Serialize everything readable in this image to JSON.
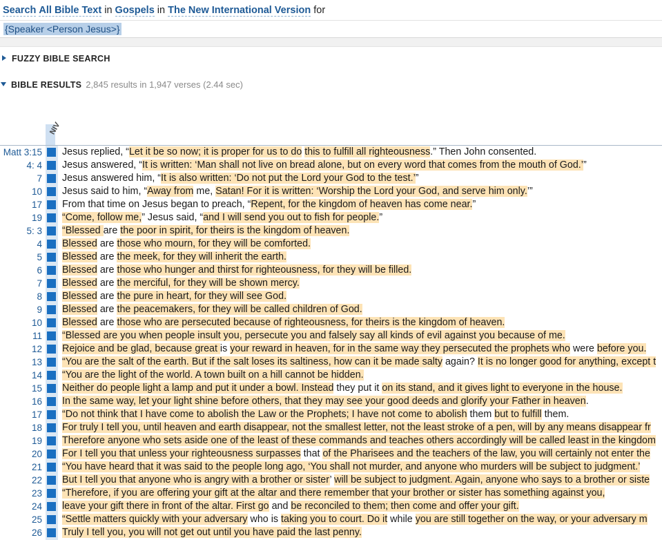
{
  "search": {
    "prefix": "Search",
    "scope": "All Bible Text",
    "in1": "in",
    "range": "Gospels",
    "in2": "in",
    "version": "The New International Version",
    "for": "for",
    "query": "{Speaker <Person Jesus>}"
  },
  "sections": {
    "fuzzy": "FUZZY BIBLE SEARCH",
    "results": "BIBLE RESULTS",
    "results_count": "2,845 results in 1,947 verses (2.44 sec)"
  },
  "version_column": "NIV",
  "colors": {
    "accent": "#1e5a96",
    "highlight": "#fde3b6",
    "marker": "#1a6fc1"
  },
  "results": [
    {
      "ref": "Matt 3:15",
      "segs": [
        [
          "Jesus replied, “",
          0
        ],
        [
          "Let it be so now; it is proper for us to do",
          1
        ],
        [
          " ",
          0
        ],
        [
          "this to fulfill all righteousness",
          1
        ],
        [
          ".” Then John consented.",
          0
        ]
      ]
    },
    {
      "ref": "4:  4",
      "segs": [
        [
          "Jesus answered, “",
          0
        ],
        [
          "It is written: ‘Man shall not live on bread alone, but on every word that comes from the mouth of God.’",
          1
        ],
        [
          "”",
          0
        ]
      ]
    },
    {
      "ref": "7",
      "segs": [
        [
          "Jesus answered him, “",
          0
        ],
        [
          "It is also written: ‘Do not put the Lord your God to the test.’",
          1
        ],
        [
          "”",
          0
        ]
      ]
    },
    {
      "ref": "10",
      "segs": [
        [
          "Jesus said to him, “",
          0
        ],
        [
          "Away from",
          1
        ],
        [
          " me, ",
          0
        ],
        [
          "Satan! For it is written: ‘Worship the Lord your God, and serve him only.",
          1
        ],
        [
          "’”",
          0
        ]
      ]
    },
    {
      "ref": "17",
      "segs": [
        [
          "From that time on Jesus began to preach, “",
          0
        ],
        [
          "Repent, for the kingdom of heaven has come near.",
          1
        ],
        [
          "”",
          0
        ]
      ]
    },
    {
      "ref": "19",
      "segs": [
        [
          "“Come, follow me,",
          1
        ],
        [
          "” Jesus said, “",
          0
        ],
        [
          "and I will send you out to fish for people.",
          1
        ],
        [
          "”",
          0
        ]
      ]
    },
    {
      "ref": "5:  3",
      "segs": [
        [
          "“Blessed ",
          1
        ],
        [
          "are ",
          0
        ],
        [
          "the poor in spirit, for theirs is the kingdom of heaven.",
          1
        ]
      ]
    },
    {
      "ref": "4",
      "segs": [
        [
          "Blessed",
          1
        ],
        [
          " are ",
          0
        ],
        [
          "those who mourn, for they will be comforted.",
          1
        ]
      ]
    },
    {
      "ref": "5",
      "segs": [
        [
          "Blessed",
          1
        ],
        [
          " are ",
          0
        ],
        [
          "the meek, for they will inherit the earth.",
          1
        ]
      ]
    },
    {
      "ref": "6",
      "segs": [
        [
          "Blessed",
          1
        ],
        [
          " are ",
          0
        ],
        [
          "those who hunger and thirst for righteousness, for they will be filled.",
          1
        ]
      ]
    },
    {
      "ref": "7",
      "segs": [
        [
          "Blessed",
          1
        ],
        [
          " are ",
          0
        ],
        [
          "the merciful, for they will be shown mercy.",
          1
        ]
      ]
    },
    {
      "ref": "8",
      "segs": [
        [
          "Blessed",
          1
        ],
        [
          " are ",
          0
        ],
        [
          "the pure in heart, for they will see God.",
          1
        ]
      ]
    },
    {
      "ref": "9",
      "segs": [
        [
          "Blessed",
          1
        ],
        [
          " are ",
          0
        ],
        [
          "the peacemakers, for they will be called children of God.",
          1
        ]
      ]
    },
    {
      "ref": "10",
      "segs": [
        [
          "Blessed",
          1
        ],
        [
          " are ",
          0
        ],
        [
          "those who are persecuted because of righteousness, for theirs is the kingdom of heaven.",
          1
        ]
      ]
    },
    {
      "ref": "11",
      "segs": [
        [
          "“Blessed are you when people insult you, persecute you and falsely say all kinds of evil against you because of me.",
          1
        ]
      ]
    },
    {
      "ref": "12",
      "segs": [
        [
          "Rejoice and be glad, because great ",
          1
        ],
        [
          "is ",
          0
        ],
        [
          "your reward in heaven, for in the same way they persecuted the prophets who",
          1
        ],
        [
          " were ",
          0
        ],
        [
          "before you.",
          1
        ]
      ]
    },
    {
      "ref": "13",
      "segs": [
        [
          "“You are the salt of the earth. But if the salt loses its saltiness, how can it be made salty",
          1
        ],
        [
          " again? ",
          0
        ],
        [
          "It is no longer good for anything, except t",
          1
        ]
      ]
    },
    {
      "ref": "14",
      "segs": [
        [
          "“You are the light of the world. A town built on a hill cannot be hidden.",
          1
        ]
      ]
    },
    {
      "ref": "15",
      "segs": [
        [
          "Neither do people light a lamp and put it under a bowl. Instead",
          1
        ],
        [
          " they put it ",
          0
        ],
        [
          "on its stand, and it gives light to everyone in the house.",
          1
        ]
      ]
    },
    {
      "ref": "16",
      "segs": [
        [
          "In the same way, let your light shine before others, that they may see your good deeds and glorify your Father in heaven",
          1
        ],
        [
          ".",
          0
        ]
      ]
    },
    {
      "ref": "17",
      "segs": [
        [
          "“Do not think that I have come to abolish the Law or the Prophets; I have not come to abolish",
          1
        ],
        [
          " them ",
          0
        ],
        [
          "but to fulfill",
          1
        ],
        [
          " them.",
          0
        ]
      ]
    },
    {
      "ref": "18",
      "segs": [
        [
          "For truly I tell you, until heaven and earth disappear, not the smallest letter, not the least stroke of a pen, will by any means disappear fr",
          1
        ]
      ]
    },
    {
      "ref": "19",
      "segs": [
        [
          "Therefore anyone who sets aside one of the least of these commands and teaches others accordingly will be called least in the kingdom",
          1
        ]
      ]
    },
    {
      "ref": "20",
      "segs": [
        [
          "For I tell you that unless your righteousness surpasses",
          1
        ],
        [
          " that ",
          0
        ],
        [
          "of the Pharisees and the teachers of the law, you will certainly not enter the",
          1
        ]
      ]
    },
    {
      "ref": "21",
      "segs": [
        [
          "“You have heard that it was said to the people long ago, ‘You shall not murder, and anyone who murders will be subject to judgment.’",
          1
        ]
      ]
    },
    {
      "ref": "22",
      "segs": [
        [
          "But I tell you that anyone who is angry with a brother or sister",
          1
        ],
        [
          "’ ",
          0
        ],
        [
          "will be subject to judgment. Again, anyone who says to a brother or siste",
          1
        ]
      ]
    },
    {
      "ref": "23",
      "segs": [
        [
          "“Therefore, if you are offering your gift at the altar and there remember that your brother or sister has something against you,",
          1
        ]
      ]
    },
    {
      "ref": "24",
      "segs": [
        [
          "leave your gift there in front of the altar. First go",
          1
        ],
        [
          " and ",
          0
        ],
        [
          "be reconciled to them; then come and offer your gift.",
          1
        ]
      ]
    },
    {
      "ref": "25",
      "segs": [
        [
          "“Settle matters quickly with your adversary",
          1
        ],
        [
          " who is ",
          0
        ],
        [
          "taking you to court. Do it",
          1
        ],
        [
          " while ",
          0
        ],
        [
          "you are still together on the way, or your adversary m",
          1
        ]
      ]
    },
    {
      "ref": "26",
      "segs": [
        [
          "Truly I tell you, you will not get out until you have paid the last penny.",
          1
        ]
      ]
    }
  ]
}
